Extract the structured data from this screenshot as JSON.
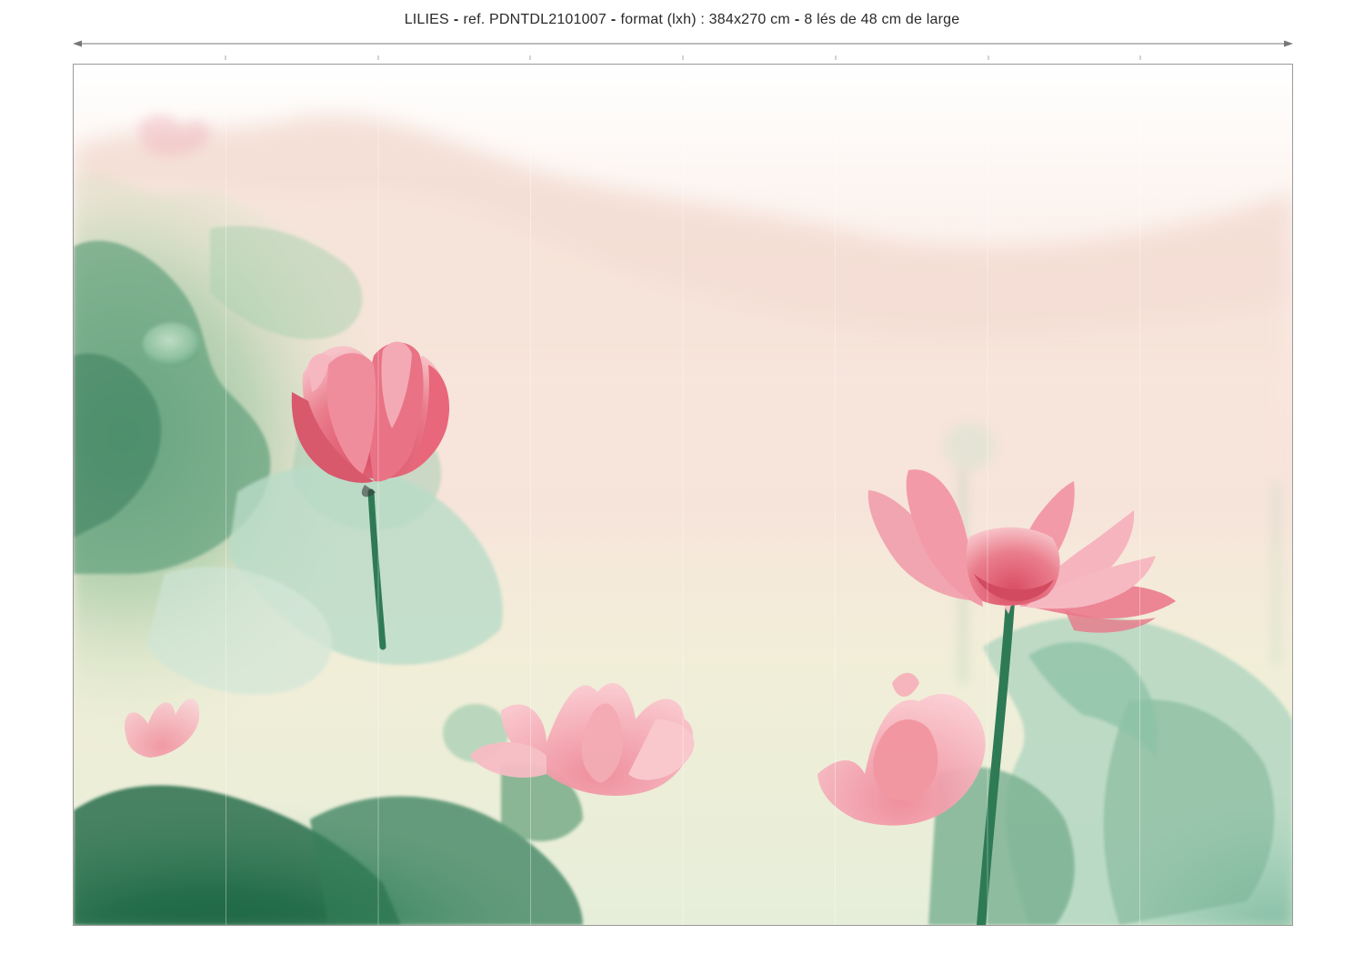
{
  "header": {
    "product_name": "LILIES",
    "reference": "ref. PDNTDL2101007",
    "format": "format (lxh) : 384x270 cm",
    "strips": "8 lés de 48 cm de large",
    "separator": "-"
  },
  "mural": {
    "strip_count": 8,
    "subject": "lotus flowers in mist",
    "colors": {
      "petal": "#e66a7e",
      "petal_light": "#f6b2bd",
      "leaf_dark": "#2f7a55",
      "leaf_light": "#a8d2b6",
      "mist": "#f8ece3"
    }
  }
}
